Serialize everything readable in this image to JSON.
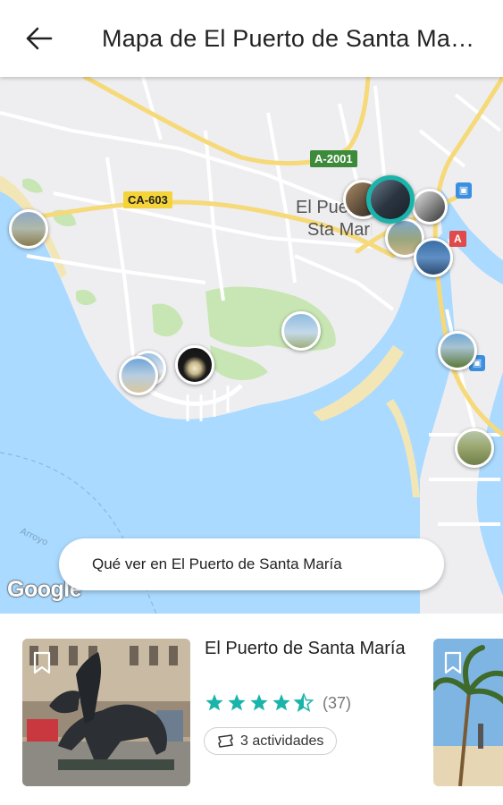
{
  "appbar": {
    "title": "Mapa de El Puerto de Santa María",
    "back_icon": "arrow-left-icon"
  },
  "map": {
    "roads": {
      "a2001": "A-2001",
      "ca603": "CA-603",
      "a4": "A"
    },
    "place_label_line1": "El Puerto de",
    "place_label_line2": "Sta María",
    "google_logo": "Google",
    "pill_label": "Qué ver en El Puerto de Santa María",
    "bg_water": "#aadaff",
    "bg_land": "#eeeef0",
    "bg_park": "#c8e6b4",
    "road_yellow": "#f6d978",
    "marker_selected_color": "#1bb4aa"
  },
  "card": {
    "title": "El Puerto de Santa María",
    "rating": 4.5,
    "review_count": "(37)",
    "activities": "3 actividades",
    "star_color": "#1bb4aa",
    "bookmark_icon": "bookmark-icon",
    "ticket_icon": "ticket-icon"
  }
}
